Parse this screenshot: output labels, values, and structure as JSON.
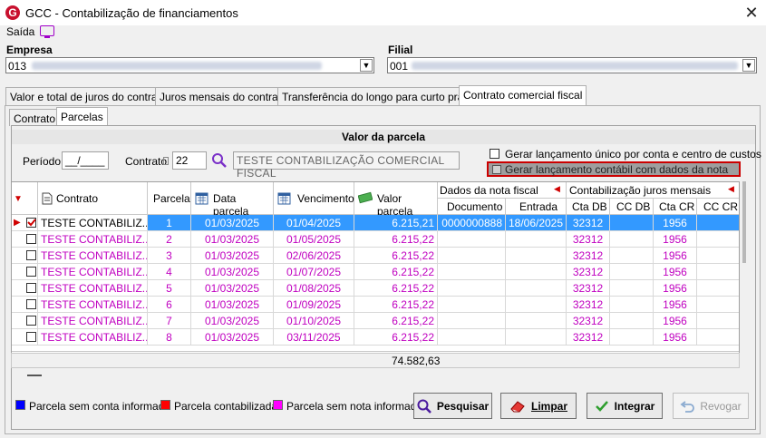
{
  "window": {
    "title": "GCC - Contabilização de financiamentos",
    "close": "✕"
  },
  "menu": {
    "saida": "Saída"
  },
  "empresa": {
    "label": "Empresa",
    "value": "013"
  },
  "filial": {
    "label": "Filial",
    "value": "001"
  },
  "tabs": [
    "Valor e total de juros do contrato",
    "Juros mensais do contrato",
    "Transferência do longo para curto prazo",
    "Contrato comercial fiscal"
  ],
  "subtabs": [
    "Contrato",
    "Parcelas"
  ],
  "section": {
    "title": "Valor da parcela"
  },
  "filters": {
    "periodo_label": "Período",
    "periodo_value": "__/____",
    "contrato_label": "Contrato",
    "contrato_value": "22",
    "contrato_desc": "TESTE CONTABILIZAÇÃO COMERCIAL FISCAL"
  },
  "options": {
    "opt1": "Gerar lançamento único por conta e centro de custos",
    "opt2": "Gerar lançamento contábil com dados da nota"
  },
  "grid": {
    "headers": {
      "contrato": "Contrato",
      "parcela": "Parcela",
      "data_parcela": "Data parcela",
      "vencimento": "Vencimento",
      "valor_parcela": "Valor parcela",
      "dados_nota": "Dados da nota fiscal",
      "documento": "Documento",
      "entrada": "Entrada",
      "contab": "Contabilização juros mensais",
      "cta_db": "Cta DB",
      "cc_db": "CC DB",
      "cta_cr": "Cta CR",
      "cc_cr": "CC CR"
    },
    "rows": [
      {
        "contrato": "TESTE CONTABILIZ...",
        "parcela": "1",
        "data": "01/03/2025",
        "venc": "01/04/2025",
        "valor": "6.215,21",
        "doc": "0000000888",
        "entrada": "18/06/2025",
        "cta_db": "32312",
        "cc_db": "",
        "cta_cr": "1956",
        "cc_cr": ""
      },
      {
        "contrato": "TESTE CONTABILIZ...",
        "parcela": "2",
        "data": "01/03/2025",
        "venc": "01/05/2025",
        "valor": "6.215,22",
        "doc": "",
        "entrada": "",
        "cta_db": "32312",
        "cc_db": "",
        "cta_cr": "1956",
        "cc_cr": ""
      },
      {
        "contrato": "TESTE CONTABILIZ...",
        "parcela": "3",
        "data": "01/03/2025",
        "venc": "02/06/2025",
        "valor": "6.215,22",
        "doc": "",
        "entrada": "",
        "cta_db": "32312",
        "cc_db": "",
        "cta_cr": "1956",
        "cc_cr": ""
      },
      {
        "contrato": "TESTE CONTABILIZ...",
        "parcela": "4",
        "data": "01/03/2025",
        "venc": "01/07/2025",
        "valor": "6.215,22",
        "doc": "",
        "entrada": "",
        "cta_db": "32312",
        "cc_db": "",
        "cta_cr": "1956",
        "cc_cr": ""
      },
      {
        "contrato": "TESTE CONTABILIZ...",
        "parcela": "5",
        "data": "01/03/2025",
        "venc": "01/08/2025",
        "valor": "6.215,22",
        "doc": "",
        "entrada": "",
        "cta_db": "32312",
        "cc_db": "",
        "cta_cr": "1956",
        "cc_cr": ""
      },
      {
        "contrato": "TESTE CONTABILIZ...",
        "parcela": "6",
        "data": "01/03/2025",
        "venc": "01/09/2025",
        "valor": "6.215,22",
        "doc": "",
        "entrada": "",
        "cta_db": "32312",
        "cc_db": "",
        "cta_cr": "1956",
        "cc_cr": ""
      },
      {
        "contrato": "TESTE CONTABILIZ...",
        "parcela": "7",
        "data": "01/03/2025",
        "venc": "01/10/2025",
        "valor": "6.215,22",
        "doc": "",
        "entrada": "",
        "cta_db": "32312",
        "cc_db": "",
        "cta_cr": "1956",
        "cc_cr": ""
      },
      {
        "contrato": "TESTE CONTABILIZ...",
        "parcela": "8",
        "data": "01/03/2025",
        "venc": "03/11/2025",
        "valor": "6.215,22",
        "doc": "",
        "entrada": "",
        "cta_db": "32312",
        "cc_db": "",
        "cta_cr": "1956",
        "cc_cr": ""
      }
    ],
    "total": "74.582,63"
  },
  "legend": [
    {
      "label": "Parcela sem conta informada",
      "color": "#0000ff"
    },
    {
      "label": "Parcela contabilizada",
      "color": "#ff0000"
    },
    {
      "label": "Parcela sem nota informada",
      "color": "#ff00ff"
    }
  ],
  "buttons": {
    "pesquisar": "Pesquisar",
    "limpar": "Limpar",
    "integrar": "Integrar",
    "revogar": "Revogar"
  },
  "colors": {
    "magenta": "#c000c0",
    "selection": "#3399ff",
    "highlight_border": "#cc0000"
  }
}
